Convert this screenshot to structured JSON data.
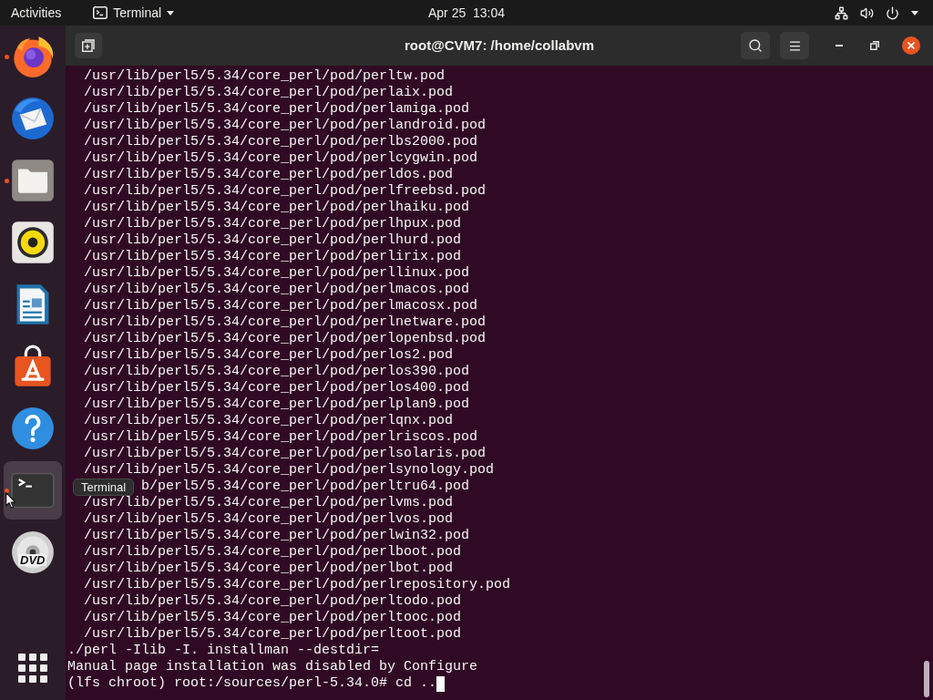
{
  "top_bar": {
    "activities": "Activities",
    "app_menu": "Terminal",
    "clock": "Apr 25  13:04"
  },
  "dock": {
    "items": [
      {
        "kind": "browser",
        "running": true,
        "hovered": false
      },
      {
        "kind": "mail",
        "running": false,
        "hovered": false
      },
      {
        "kind": "files",
        "running": true,
        "hovered": false
      },
      {
        "kind": "music",
        "running": false,
        "hovered": false
      },
      {
        "kind": "document",
        "running": false,
        "hovered": false
      },
      {
        "kind": "store",
        "running": false,
        "hovered": false
      },
      {
        "kind": "help",
        "running": false,
        "hovered": false
      },
      {
        "kind": "terminal",
        "running": true,
        "hovered": true
      },
      {
        "kind": "disc",
        "running": false,
        "hovered": false,
        "label": "DVD"
      }
    ]
  },
  "tooltip": {
    "text": "Terminal"
  },
  "window": {
    "title": "root@CVM7: /home/collabvm"
  },
  "terminal": {
    "lines": [
      {
        "kind": "listing",
        "text": "/usr/lib/perl5/5.34/core_perl/pod/perltw.pod"
      },
      {
        "kind": "listing",
        "text": "/usr/lib/perl5/5.34/core_perl/pod/perlaix.pod"
      },
      {
        "kind": "listing",
        "text": "/usr/lib/perl5/5.34/core_perl/pod/perlamiga.pod"
      },
      {
        "kind": "listing",
        "text": "/usr/lib/perl5/5.34/core_perl/pod/perlandroid.pod"
      },
      {
        "kind": "listing",
        "text": "/usr/lib/perl5/5.34/core_perl/pod/perlbs2000.pod"
      },
      {
        "kind": "listing",
        "text": "/usr/lib/perl5/5.34/core_perl/pod/perlcygwin.pod"
      },
      {
        "kind": "listing",
        "text": "/usr/lib/perl5/5.34/core_perl/pod/perldos.pod"
      },
      {
        "kind": "listing",
        "text": "/usr/lib/perl5/5.34/core_perl/pod/perlfreebsd.pod"
      },
      {
        "kind": "listing",
        "text": "/usr/lib/perl5/5.34/core_perl/pod/perlhaiku.pod"
      },
      {
        "kind": "listing",
        "text": "/usr/lib/perl5/5.34/core_perl/pod/perlhpux.pod"
      },
      {
        "kind": "listing",
        "text": "/usr/lib/perl5/5.34/core_perl/pod/perlhurd.pod"
      },
      {
        "kind": "listing",
        "text": "/usr/lib/perl5/5.34/core_perl/pod/perlirix.pod"
      },
      {
        "kind": "listing",
        "text": "/usr/lib/perl5/5.34/core_perl/pod/perllinux.pod"
      },
      {
        "kind": "listing",
        "text": "/usr/lib/perl5/5.34/core_perl/pod/perlmacos.pod"
      },
      {
        "kind": "listing",
        "text": "/usr/lib/perl5/5.34/core_perl/pod/perlmacosx.pod"
      },
      {
        "kind": "listing",
        "text": "/usr/lib/perl5/5.34/core_perl/pod/perlnetware.pod"
      },
      {
        "kind": "listing",
        "text": "/usr/lib/perl5/5.34/core_perl/pod/perlopenbsd.pod"
      },
      {
        "kind": "listing",
        "text": "/usr/lib/perl5/5.34/core_perl/pod/perlos2.pod"
      },
      {
        "kind": "listing",
        "text": "/usr/lib/perl5/5.34/core_perl/pod/perlos390.pod"
      },
      {
        "kind": "listing",
        "text": "/usr/lib/perl5/5.34/core_perl/pod/perlos400.pod"
      },
      {
        "kind": "listing",
        "text": "/usr/lib/perl5/5.34/core_perl/pod/perlplan9.pod"
      },
      {
        "kind": "listing",
        "text": "/usr/lib/perl5/5.34/core_perl/pod/perlqnx.pod"
      },
      {
        "kind": "listing",
        "text": "/usr/lib/perl5/5.34/core_perl/pod/perlriscos.pod"
      },
      {
        "kind": "listing",
        "text": "/usr/lib/perl5/5.34/core_perl/pod/perlsolaris.pod"
      },
      {
        "kind": "listing",
        "text": "/usr/lib/perl5/5.34/core_perl/pod/perlsynology.pod"
      },
      {
        "kind": "covered",
        "text": "b/perl5/5.34/core_perl/pod/perltru64.pod"
      },
      {
        "kind": "listing",
        "text": "/usr/lib/perl5/5.34/core_perl/pod/perlvms.pod"
      },
      {
        "kind": "listing",
        "text": "/usr/lib/perl5/5.34/core_perl/pod/perlvos.pod"
      },
      {
        "kind": "listing",
        "text": "/usr/lib/perl5/5.34/core_perl/pod/perlwin32.pod"
      },
      {
        "kind": "listing",
        "text": "/usr/lib/perl5/5.34/core_perl/pod/perlboot.pod"
      },
      {
        "kind": "listing",
        "text": "/usr/lib/perl5/5.34/core_perl/pod/perlbot.pod"
      },
      {
        "kind": "listing",
        "text": "/usr/lib/perl5/5.34/core_perl/pod/perlrepository.pod"
      },
      {
        "kind": "listing",
        "text": "/usr/lib/perl5/5.34/core_perl/pod/perltodo.pod"
      },
      {
        "kind": "listing",
        "text": "/usr/lib/perl5/5.34/core_perl/pod/perltooc.pod"
      },
      {
        "kind": "listing",
        "text": "/usr/lib/perl5/5.34/core_perl/pod/perltoot.pod"
      },
      {
        "kind": "output",
        "text": "./perl -Ilib -I. installman --destdir="
      },
      {
        "kind": "output",
        "text": "Manual page installation was disabled by Configure"
      },
      {
        "kind": "prompt",
        "text": "(lfs chroot) root:/sources/perl-5.34.0# cd .."
      }
    ]
  }
}
